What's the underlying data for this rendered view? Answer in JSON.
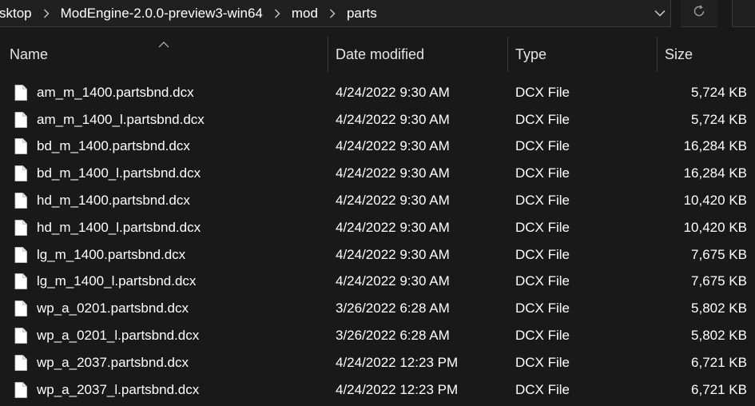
{
  "address": {
    "crumbs": [
      "sktop",
      "ModEngine-2.0.0-preview3-win64",
      "mod",
      "parts"
    ],
    "dropdown_icon": "chevron-down-icon",
    "refresh_icon": "refresh-icon"
  },
  "columns": {
    "name": "Name",
    "date": "Date modified",
    "type": "Type",
    "size": "Size"
  },
  "files": [
    {
      "name": "am_m_1400.partsbnd.dcx",
      "date": "4/24/2022 9:30 AM",
      "type": "DCX File",
      "size": "5,724 KB"
    },
    {
      "name": "am_m_1400_l.partsbnd.dcx",
      "date": "4/24/2022 9:30 AM",
      "type": "DCX File",
      "size": "5,724 KB"
    },
    {
      "name": "bd_m_1400.partsbnd.dcx",
      "date": "4/24/2022 9:30 AM",
      "type": "DCX File",
      "size": "16,284 KB"
    },
    {
      "name": "bd_m_1400_l.partsbnd.dcx",
      "date": "4/24/2022 9:30 AM",
      "type": "DCX File",
      "size": "16,284 KB"
    },
    {
      "name": "hd_m_1400.partsbnd.dcx",
      "date": "4/24/2022 9:30 AM",
      "type": "DCX File",
      "size": "10,420 KB"
    },
    {
      "name": "hd_m_1400_l.partsbnd.dcx",
      "date": "4/24/2022 9:30 AM",
      "type": "DCX File",
      "size": "10,420 KB"
    },
    {
      "name": "lg_m_1400.partsbnd.dcx",
      "date": "4/24/2022 9:30 AM",
      "type": "DCX File",
      "size": "7,675 KB"
    },
    {
      "name": "lg_m_1400_l.partsbnd.dcx",
      "date": "4/24/2022 9:30 AM",
      "type": "DCX File",
      "size": "7,675 KB"
    },
    {
      "name": "wp_a_0201.partsbnd.dcx",
      "date": "3/26/2022 6:28 AM",
      "type": "DCX File",
      "size": "5,802 KB"
    },
    {
      "name": "wp_a_0201_l.partsbnd.dcx",
      "date": "3/26/2022 6:28 AM",
      "type": "DCX File",
      "size": "5,802 KB"
    },
    {
      "name": "wp_a_2037.partsbnd.dcx",
      "date": "4/24/2022 12:23 PM",
      "type": "DCX File",
      "size": "6,721 KB"
    },
    {
      "name": "wp_a_2037_l.partsbnd.dcx",
      "date": "4/24/2022 12:23 PM",
      "type": "DCX File",
      "size": "6,721 KB"
    }
  ],
  "file_icon": "file-icon",
  "colors": {
    "background": "#191919",
    "text": "#ffffff",
    "divider": "#3a3a3a"
  }
}
